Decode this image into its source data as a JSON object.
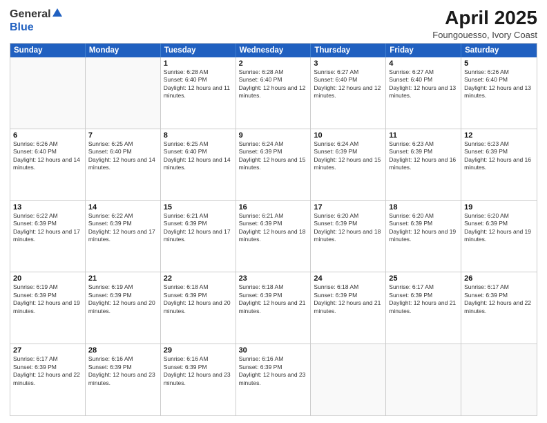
{
  "logo": {
    "general": "General",
    "blue": "Blue"
  },
  "header": {
    "title": "April 2025",
    "subtitle": "Foungouesso, Ivory Coast"
  },
  "weekdays": [
    "Sunday",
    "Monday",
    "Tuesday",
    "Wednesday",
    "Thursday",
    "Friday",
    "Saturday"
  ],
  "weeks": [
    [
      {
        "day": "",
        "info": ""
      },
      {
        "day": "",
        "info": ""
      },
      {
        "day": "1",
        "info": "Sunrise: 6:28 AM\nSunset: 6:40 PM\nDaylight: 12 hours and 11 minutes."
      },
      {
        "day": "2",
        "info": "Sunrise: 6:28 AM\nSunset: 6:40 PM\nDaylight: 12 hours and 12 minutes."
      },
      {
        "day": "3",
        "info": "Sunrise: 6:27 AM\nSunset: 6:40 PM\nDaylight: 12 hours and 12 minutes."
      },
      {
        "day": "4",
        "info": "Sunrise: 6:27 AM\nSunset: 6:40 PM\nDaylight: 12 hours and 13 minutes."
      },
      {
        "day": "5",
        "info": "Sunrise: 6:26 AM\nSunset: 6:40 PM\nDaylight: 12 hours and 13 minutes."
      }
    ],
    [
      {
        "day": "6",
        "info": "Sunrise: 6:26 AM\nSunset: 6:40 PM\nDaylight: 12 hours and 14 minutes."
      },
      {
        "day": "7",
        "info": "Sunrise: 6:25 AM\nSunset: 6:40 PM\nDaylight: 12 hours and 14 minutes."
      },
      {
        "day": "8",
        "info": "Sunrise: 6:25 AM\nSunset: 6:40 PM\nDaylight: 12 hours and 14 minutes."
      },
      {
        "day": "9",
        "info": "Sunrise: 6:24 AM\nSunset: 6:39 PM\nDaylight: 12 hours and 15 minutes."
      },
      {
        "day": "10",
        "info": "Sunrise: 6:24 AM\nSunset: 6:39 PM\nDaylight: 12 hours and 15 minutes."
      },
      {
        "day": "11",
        "info": "Sunrise: 6:23 AM\nSunset: 6:39 PM\nDaylight: 12 hours and 16 minutes."
      },
      {
        "day": "12",
        "info": "Sunrise: 6:23 AM\nSunset: 6:39 PM\nDaylight: 12 hours and 16 minutes."
      }
    ],
    [
      {
        "day": "13",
        "info": "Sunrise: 6:22 AM\nSunset: 6:39 PM\nDaylight: 12 hours and 17 minutes."
      },
      {
        "day": "14",
        "info": "Sunrise: 6:22 AM\nSunset: 6:39 PM\nDaylight: 12 hours and 17 minutes."
      },
      {
        "day": "15",
        "info": "Sunrise: 6:21 AM\nSunset: 6:39 PM\nDaylight: 12 hours and 17 minutes."
      },
      {
        "day": "16",
        "info": "Sunrise: 6:21 AM\nSunset: 6:39 PM\nDaylight: 12 hours and 18 minutes."
      },
      {
        "day": "17",
        "info": "Sunrise: 6:20 AM\nSunset: 6:39 PM\nDaylight: 12 hours and 18 minutes."
      },
      {
        "day": "18",
        "info": "Sunrise: 6:20 AM\nSunset: 6:39 PM\nDaylight: 12 hours and 19 minutes."
      },
      {
        "day": "19",
        "info": "Sunrise: 6:20 AM\nSunset: 6:39 PM\nDaylight: 12 hours and 19 minutes."
      }
    ],
    [
      {
        "day": "20",
        "info": "Sunrise: 6:19 AM\nSunset: 6:39 PM\nDaylight: 12 hours and 19 minutes."
      },
      {
        "day": "21",
        "info": "Sunrise: 6:19 AM\nSunset: 6:39 PM\nDaylight: 12 hours and 20 minutes."
      },
      {
        "day": "22",
        "info": "Sunrise: 6:18 AM\nSunset: 6:39 PM\nDaylight: 12 hours and 20 minutes."
      },
      {
        "day": "23",
        "info": "Sunrise: 6:18 AM\nSunset: 6:39 PM\nDaylight: 12 hours and 21 minutes."
      },
      {
        "day": "24",
        "info": "Sunrise: 6:18 AM\nSunset: 6:39 PM\nDaylight: 12 hours and 21 minutes."
      },
      {
        "day": "25",
        "info": "Sunrise: 6:17 AM\nSunset: 6:39 PM\nDaylight: 12 hours and 21 minutes."
      },
      {
        "day": "26",
        "info": "Sunrise: 6:17 AM\nSunset: 6:39 PM\nDaylight: 12 hours and 22 minutes."
      }
    ],
    [
      {
        "day": "27",
        "info": "Sunrise: 6:17 AM\nSunset: 6:39 PM\nDaylight: 12 hours and 22 minutes."
      },
      {
        "day": "28",
        "info": "Sunrise: 6:16 AM\nSunset: 6:39 PM\nDaylight: 12 hours and 23 minutes."
      },
      {
        "day": "29",
        "info": "Sunrise: 6:16 AM\nSunset: 6:39 PM\nDaylight: 12 hours and 23 minutes."
      },
      {
        "day": "30",
        "info": "Sunrise: 6:16 AM\nSunset: 6:39 PM\nDaylight: 12 hours and 23 minutes."
      },
      {
        "day": "",
        "info": ""
      },
      {
        "day": "",
        "info": ""
      },
      {
        "day": "",
        "info": ""
      }
    ]
  ]
}
